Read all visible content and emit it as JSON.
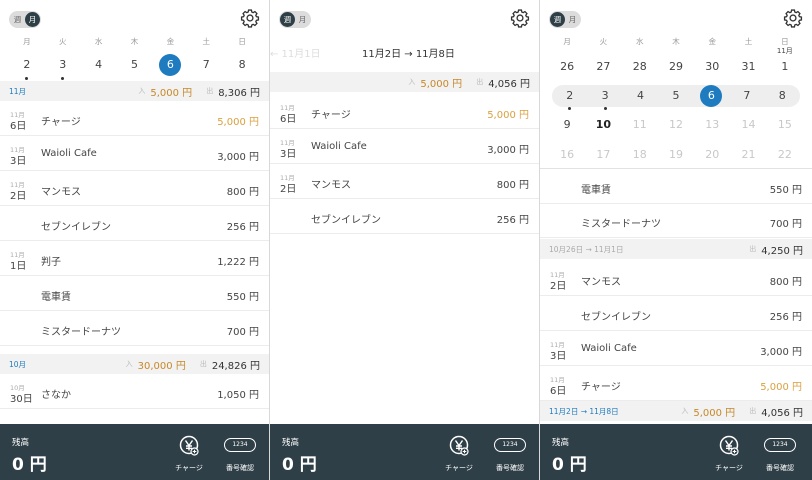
{
  "toggle": {
    "week": "週",
    "month": "月"
  },
  "dow": [
    "月",
    "火",
    "水",
    "木",
    "金",
    "土",
    "日"
  ],
  "screen1": {
    "week_dates": [
      {
        "n": "2",
        "dot": true,
        "sel": false
      },
      {
        "n": "3",
        "dot": true,
        "sel": false
      },
      {
        "n": "4",
        "dot": false,
        "sel": false
      },
      {
        "n": "5",
        "dot": false,
        "sel": false
      },
      {
        "n": "6",
        "dot": false,
        "sel": true
      },
      {
        "n": "7",
        "dot": false,
        "sel": false
      },
      {
        "n": "8",
        "dot": false,
        "sel": false
      }
    ],
    "sec_nov": {
      "label": "11月",
      "in_label": "入",
      "in_val": "5,000 円",
      "out_label": "出",
      "out_val": "8,306 円"
    },
    "rows": [
      {
        "m": "11月",
        "d": "6日",
        "name": "チャージ",
        "amt": "5,000 円",
        "income": true
      },
      {
        "m": "11月",
        "d": "3日",
        "name": "Waioli Cafe",
        "amt": "3,000 円",
        "income": false
      },
      {
        "m": "11月",
        "d": "2日",
        "name": "マンモス",
        "amt": "800 円",
        "income": false
      },
      {
        "m": "",
        "d": "",
        "name": "セブンイレブン",
        "amt": "256 円",
        "income": false
      },
      {
        "m": "11月",
        "d": "1日",
        "name": "判子",
        "amt": "1,222 円",
        "income": false
      },
      {
        "m": "",
        "d": "",
        "name": "電車賃",
        "amt": "550 円",
        "income": false
      },
      {
        "m": "",
        "d": "",
        "name": "ミスタードーナツ",
        "amt": "700 円",
        "income": false
      }
    ],
    "sec_oct": {
      "label": "10月",
      "in_label": "入",
      "in_val": "30,000 円",
      "out_label": "出",
      "out_val": "24,826 円"
    },
    "row_oct": {
      "m": "10月",
      "d": "30日",
      "name": "さなか",
      "amt": "1,050 円"
    }
  },
  "screen2": {
    "prev_range": "← 11月1日",
    "cur_range": "11月2日 → 11月8日",
    "sec": {
      "in_label": "入",
      "in_val": "5,000 円",
      "out_label": "出",
      "out_val": "4,056 円"
    },
    "rows": [
      {
        "m": "11月",
        "d": "6日",
        "name": "チャージ",
        "amt": "5,000 円",
        "income": true
      },
      {
        "m": "11月",
        "d": "3日",
        "name": "Waioli Cafe",
        "amt": "3,000 円",
        "income": false
      },
      {
        "m": "11月",
        "d": "2日",
        "name": "マンモス",
        "amt": "800 円",
        "income": false
      },
      {
        "m": "",
        "d": "",
        "name": "セブンイレブン",
        "amt": "256 円",
        "income": false
      }
    ]
  },
  "screen3": {
    "weeks": [
      [
        {
          "n": "26"
        },
        {
          "n": "27"
        },
        {
          "n": "28"
        },
        {
          "n": "29"
        },
        {
          "n": "30"
        },
        {
          "n": "31"
        },
        {
          "n": "1",
          "m": "11月"
        }
      ],
      [
        {
          "n": "2",
          "dot": true
        },
        {
          "n": "3",
          "dot": true
        },
        {
          "n": "4"
        },
        {
          "n": "5"
        },
        {
          "n": "6",
          "sel": true
        },
        {
          "n": "7"
        },
        {
          "n": "8"
        }
      ],
      [
        {
          "n": "9"
        },
        {
          "n": "10",
          "bold": true
        },
        {
          "n": "11",
          "faded": true
        },
        {
          "n": "12",
          "faded": true
        },
        {
          "n": "13",
          "faded": true
        },
        {
          "n": "14",
          "faded": true
        },
        {
          "n": "15",
          "faded": true
        }
      ],
      [
        {
          "n": "16",
          "faded": true
        },
        {
          "n": "17",
          "faded": true
        },
        {
          "n": "18",
          "faded": true
        },
        {
          "n": "19",
          "faded": true
        },
        {
          "n": "20",
          "faded": true
        },
        {
          "n": "21",
          "faded": true
        },
        {
          "n": "22",
          "faded": true
        }
      ]
    ],
    "top_rows": [
      {
        "name": "電車賃",
        "amt": "550 円"
      },
      {
        "name": "ミスタードーナツ",
        "amt": "700 円"
      }
    ],
    "sec1": {
      "label": "10月26日 → 11月1日",
      "out_label": "出",
      "out_val": "4,250 円"
    },
    "rows": [
      {
        "m": "11月",
        "d": "2日",
        "name": "マンモス",
        "amt": "800 円",
        "income": false
      },
      {
        "m": "",
        "d": "",
        "name": "セブンイレブン",
        "amt": "256 円",
        "income": false
      },
      {
        "m": "11月",
        "d": "3日",
        "name": "Waioli Cafe",
        "amt": "3,000 円",
        "income": false
      },
      {
        "m": "11月",
        "d": "6日",
        "name": "チャージ",
        "amt": "5,000 円",
        "income": true
      }
    ],
    "sec2": {
      "label": "11月2日 → 11月8日",
      "in_label": "入",
      "in_val": "5,000 円",
      "out_label": "出",
      "out_val": "4,056 円"
    }
  },
  "bottom": {
    "balance_label": "残高",
    "balance_value": "0 円",
    "charge_label": "チャージ",
    "number_label": "番号確認",
    "number_pill": "1234"
  },
  "icons": {
    "settings": "gear-icon",
    "charge": "yen-icon"
  },
  "colors": {
    "accent": "#1e7bbf",
    "income": "#d9a040",
    "bar": "#2f3f47"
  }
}
